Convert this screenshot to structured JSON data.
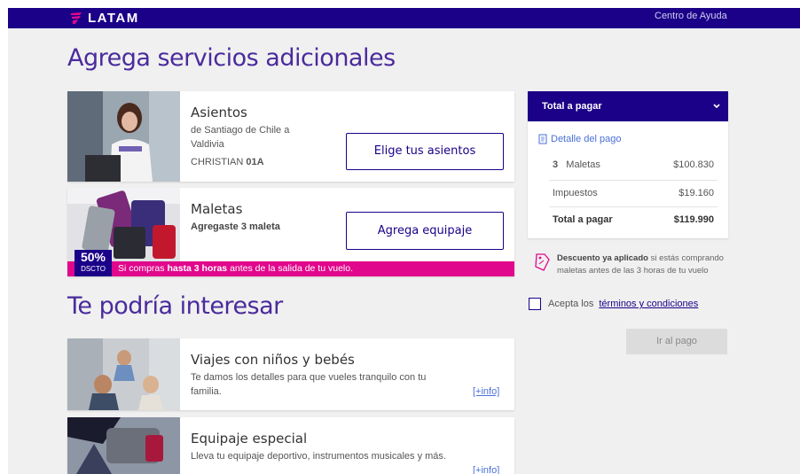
{
  "header": {
    "logo_text": "LATAM",
    "help_link": "Centro de Ayuda"
  },
  "title": "Agrega servicios adicionales",
  "seats_card": {
    "title": "Asientos",
    "route": "de Santiago de Chile a Valdivia",
    "passenger": "CHRISTIAN",
    "seat": "01A",
    "button": "Elige tus asientos"
  },
  "bags_card": {
    "title": "Maletas",
    "added": "Agregaste 3 maleta",
    "button": "Agrega equipaje",
    "discount_pct": "50%",
    "discount_label": "DSCTO",
    "promo_pre": "Si compras",
    "promo_bold": "hasta 3 horas",
    "promo_post": "antes de la salida de tu vuelo."
  },
  "interest_title": "Te podría interesar",
  "interest_cards": [
    {
      "title": "Viajes con niños y bebés",
      "desc": "Te damos los detalles para que vueles tranquilo con tu familia.",
      "more": "[+info]"
    },
    {
      "title": "Equipaje especial",
      "desc": "Lleva tu equipaje deportivo, instrumentos musicales y más.",
      "more": "[+info]"
    }
  ],
  "summary": {
    "header": "Total a pagar",
    "detail_link": "Detalle del pago",
    "bags_qty": "3",
    "bags_label": "Maletas",
    "bags_amount": "$100.830",
    "taxes_label": "Impuestos",
    "taxes_amount": "$19.160",
    "total_label": "Total a pagar",
    "total_amount": "$119.990"
  },
  "discount_note": {
    "bold": "Descuento ya aplicado",
    "rest": "si estás comprando maletas antes de las 3 horas de tu vuelo"
  },
  "terms": {
    "prefix": "Acepta los",
    "link": "términos y condiciones"
  },
  "pay_button": "Ir al pago",
  "colors": {
    "brand": "#1b0088",
    "accent": "#e1078c",
    "title": "#4a2b9c",
    "link": "#4a6fd8"
  }
}
